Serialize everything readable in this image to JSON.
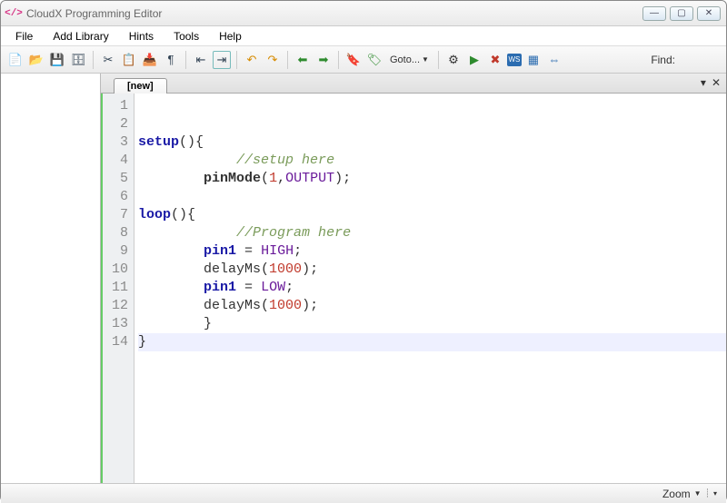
{
  "window": {
    "title": "CloudX Programming Editor"
  },
  "menu": {
    "file": "File",
    "addLibrary": "Add Library",
    "hints": "Hints",
    "tools": "Tools",
    "help": "Help"
  },
  "toolbar": {
    "goto": "Goto...",
    "find_label": "Find:"
  },
  "tabs": {
    "active": "[new]"
  },
  "code": {
    "lines": [
      {
        "n": 1,
        "tokens": []
      },
      {
        "n": 2,
        "tokens": []
      },
      {
        "n": 3,
        "tokens": [
          {
            "t": "setup",
            "c": "kw"
          },
          {
            "t": "(){",
            "c": "punc"
          }
        ]
      },
      {
        "n": 4,
        "tokens": [
          {
            "t": "            ",
            "c": ""
          },
          {
            "t": "//setup here",
            "c": "cmt"
          }
        ]
      },
      {
        "n": 5,
        "tokens": [
          {
            "t": "        ",
            "c": ""
          },
          {
            "t": "pinMode",
            "c": "fn"
          },
          {
            "t": "(",
            "c": "punc"
          },
          {
            "t": "1",
            "c": "num"
          },
          {
            "t": ",",
            "c": "punc"
          },
          {
            "t": "OUTPUT",
            "c": "const"
          },
          {
            "t": ");",
            "c": "punc"
          }
        ]
      },
      {
        "n": 6,
        "tokens": []
      },
      {
        "n": 7,
        "tokens": [
          {
            "t": "loop",
            "c": "kw"
          },
          {
            "t": "(){",
            "c": "punc"
          }
        ]
      },
      {
        "n": 8,
        "tokens": [
          {
            "t": "            ",
            "c": ""
          },
          {
            "t": "//Program here",
            "c": "cmt"
          }
        ]
      },
      {
        "n": 9,
        "tokens": [
          {
            "t": "        ",
            "c": ""
          },
          {
            "t": "pin1",
            "c": "kw2"
          },
          {
            "t": " = ",
            "c": "punc"
          },
          {
            "t": "HIGH",
            "c": "const"
          },
          {
            "t": ";",
            "c": "punc"
          }
        ]
      },
      {
        "n": 10,
        "tokens": [
          {
            "t": "        ",
            "c": ""
          },
          {
            "t": "delayMs(",
            "c": "punc"
          },
          {
            "t": "1000",
            "c": "num"
          },
          {
            "t": ");",
            "c": "punc"
          }
        ]
      },
      {
        "n": 11,
        "tokens": [
          {
            "t": "        ",
            "c": ""
          },
          {
            "t": "pin1",
            "c": "kw2"
          },
          {
            "t": " = ",
            "c": "punc"
          },
          {
            "t": "LOW",
            "c": "const"
          },
          {
            "t": ";",
            "c": "punc"
          }
        ]
      },
      {
        "n": 12,
        "tokens": [
          {
            "t": "        ",
            "c": ""
          },
          {
            "t": "delayMs(",
            "c": "punc"
          },
          {
            "t": "1000",
            "c": "num"
          },
          {
            "t": ");",
            "c": "punc"
          }
        ]
      },
      {
        "n": 13,
        "tokens": [
          {
            "t": "        }",
            "c": "punc"
          }
        ]
      },
      {
        "n": 14,
        "tokens": [
          {
            "t": "}",
            "c": "punc"
          }
        ],
        "hl": true
      }
    ]
  },
  "status": {
    "zoom": "Zoom"
  }
}
